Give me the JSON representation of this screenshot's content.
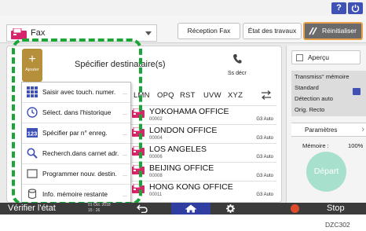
{
  "topbar": {
    "help_label": "?"
  },
  "header": {
    "app_title": "Fax",
    "reception_label": "Réception Fax",
    "jobs_label": "État des travaux",
    "reset_label": "Réinitialiser"
  },
  "destinations": {
    "add_label": "Ajouter",
    "add_symbol": "+",
    "title": "Spécifier destinataire(s)",
    "no_number_label": "Ss décr",
    "alpha_tabs": [
      "LMN",
      "OPQ",
      "RST",
      "UVW",
      "XYZ"
    ],
    "entries": [
      {
        "name": "YOKOHAMA OFFICE",
        "number": "00002",
        "mode": "G3 Auto"
      },
      {
        "name": "LONDON OFFICE",
        "number": "00004",
        "mode": "G3 Auto"
      },
      {
        "name": "LOS ANGELES",
        "number": "00006",
        "mode": "G3 Auto"
      },
      {
        "name": "BEIJING OFFICE",
        "number": "00008",
        "mode": "G3 Auto"
      },
      {
        "name": "HONG KONG OFFICE",
        "number": "00011",
        "mode": "G3 Auto"
      }
    ]
  },
  "popup_menu": {
    "items": [
      {
        "label": "Saisir avec touch. numer.",
        "icon": "keypad-icon"
      },
      {
        "label": "Sélect. dans l'historique",
        "icon": "history-clock-icon"
      },
      {
        "label": "Spécifier par n° enreg.",
        "icon": "number-123-icon"
      },
      {
        "label": "Recherch.dans carnet adr.",
        "icon": "search-icon"
      },
      {
        "label": "Programmer nouv. destin.",
        "icon": "program-destination-icon"
      },
      {
        "label": "Info. mémoire restante",
        "icon": "memory-cylinder-icon"
      }
    ],
    "dots": "..."
  },
  "right_panel": {
    "preview_label": "Aperçu",
    "settings": [
      "Transmiss° mémoire",
      "Standard",
      "Détection auto",
      "Orig. Recto"
    ],
    "params_label": "Paramètres",
    "memory_label": "Mémoire :",
    "memory_value": "100%",
    "start_label": "Départ"
  },
  "bottom_bar": {
    "verify_label": "Vérifier l'état",
    "date": "01 Oct. 2018",
    "time": "15 : 26",
    "stop_label": "Stop"
  },
  "colors": {
    "highlight": "#1aa637",
    "add_tile": "#b58f3a",
    "accent_blue": "#3f51b5",
    "fax_icon": "#d6256b",
    "start_button": "#a8e0ce",
    "stop_red": "#e04a2a"
  },
  "caption": "DZC302"
}
